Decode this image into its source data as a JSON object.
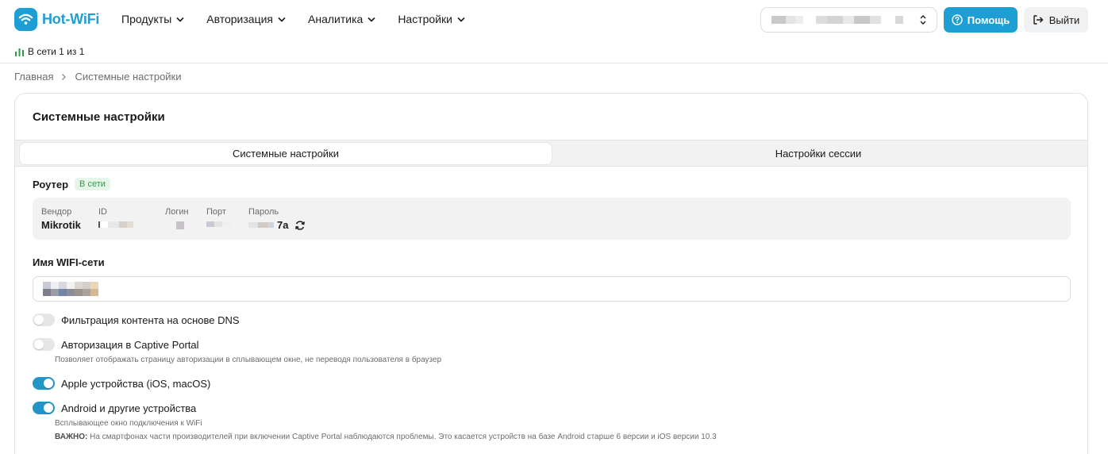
{
  "brand": {
    "name": "Hot-WiFi",
    "color": "#1e9fd4"
  },
  "nav": [
    {
      "label": "Продукты"
    },
    {
      "label": "Авторизация"
    },
    {
      "label": "Аналитика"
    },
    {
      "label": "Настройки"
    }
  ],
  "header": {
    "help_label": "Помощь",
    "logout_label": "Выйти",
    "online_status": "В сети 1 из 1"
  },
  "breadcrumb": {
    "home": "Главная",
    "current": "Системные настройки"
  },
  "card": {
    "title": "Системные настройки",
    "tabs": [
      {
        "label": "Системные настройки",
        "active": true
      },
      {
        "label": "Настройки сессии",
        "active": false
      }
    ]
  },
  "router": {
    "label": "Роутер",
    "status": "В сети",
    "fields": {
      "vendor": {
        "label": "Вендор",
        "value": "Mikrotik"
      },
      "id": {
        "label": "ID"
      },
      "login": {
        "label": "Логин"
      },
      "port": {
        "label": "Порт"
      },
      "password": {
        "label": "Пароль",
        "value_suffix": "7a"
      }
    }
  },
  "wifi": {
    "label": "Имя WIFI-сети"
  },
  "toggles": {
    "dns": {
      "label": "Фильтрация контента на основе DNS",
      "on": false
    },
    "captive": {
      "label": "Авторизация в Captive Portal",
      "on": false,
      "hint": "Позволяет отображать страницу авторизации в сплывающем окне, не переводя пользователя в браузер"
    },
    "apple": {
      "label": "Apple устройства (iOS, macOS)",
      "on": true
    },
    "android": {
      "label": "Android и другие устройства",
      "on": true,
      "hint": "Всплывающее окно подключения к WiFi",
      "warning_strong": "ВАЖНО:",
      "warning_text": " На смартфонах части производителей при включении Captive Portal наблюдаются проблемы. Это касается устройств на базе Android старше 6 версии и iOS версии 10.3"
    }
  },
  "colors": {
    "accent": "#1e9fd4",
    "toggle_on": "#2195c6",
    "online_green": "#2e9b45"
  }
}
